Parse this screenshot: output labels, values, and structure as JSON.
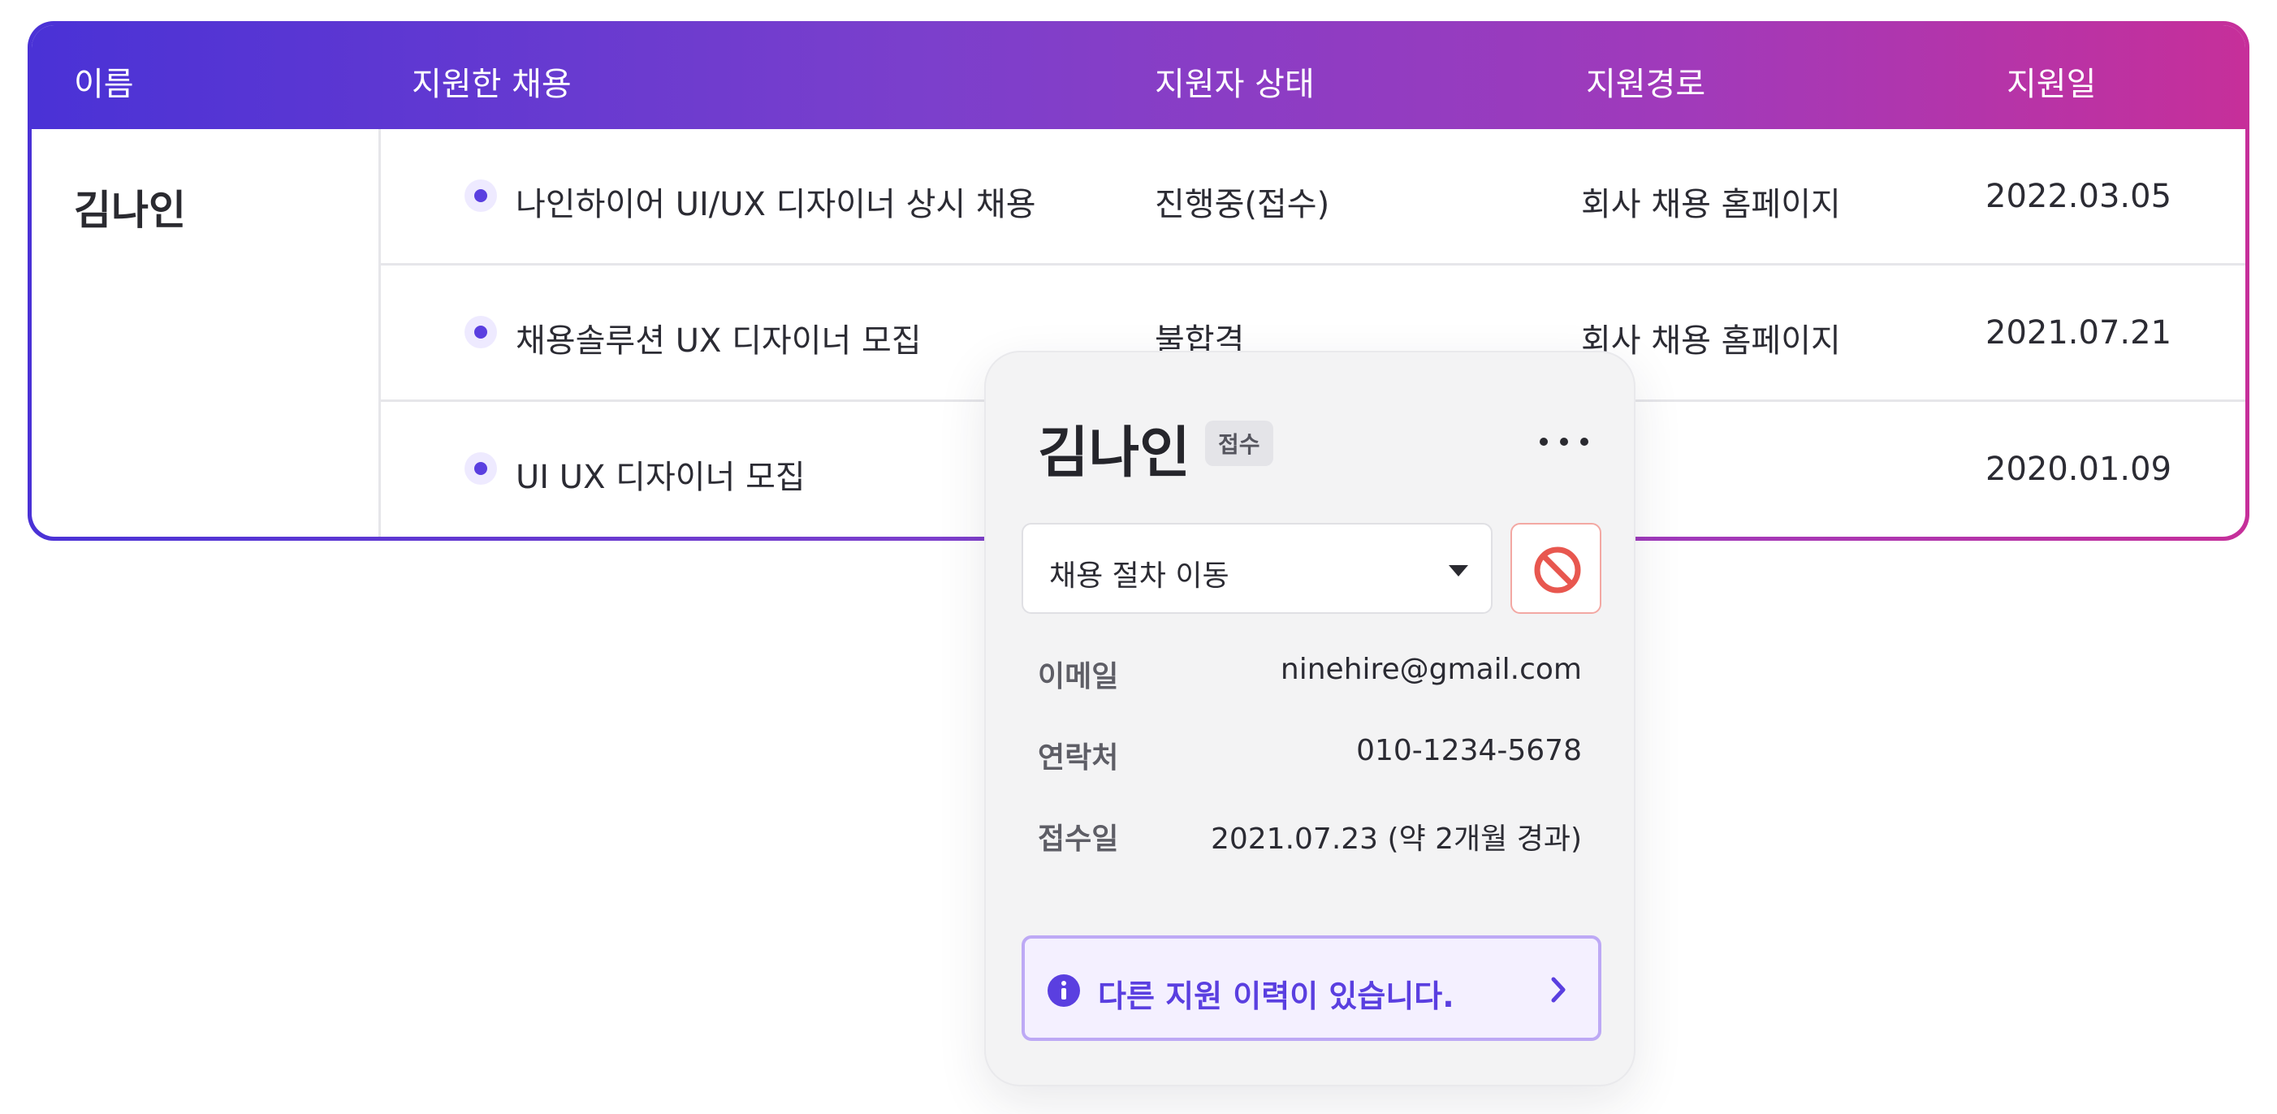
{
  "table": {
    "headers": {
      "name": "이름",
      "job": "지원한 채용",
      "status": "지원자 상태",
      "source": "지원경로",
      "date": "지원일"
    },
    "applicant_name": "김나인",
    "rows": [
      {
        "job": "나인하이어 UI/UX 디자이너 상시 채용",
        "status": "진행중(접수)",
        "source": "회사 채용 홈페이지",
        "date": "2022.03.05"
      },
      {
        "job": "채용솔루션 UX 디자이너 모집",
        "status": "불합격",
        "source": "회사 채용 홈페이지",
        "date": "2021.07.21"
      },
      {
        "job": "UI UX 디자이너 모집",
        "status": "",
        "source": "",
        "date": "2020.01.09"
      }
    ]
  },
  "card": {
    "name": "김나인",
    "badge": "접수",
    "select_label": "채용 절차 이동",
    "info": [
      {
        "label": "이메일",
        "value": "ninehire@gmail.com"
      },
      {
        "label": "연락처",
        "value": "010-1234-5678"
      },
      {
        "label": "접수일",
        "value": "2021.07.23 (약 2개월 경과)"
      }
    ],
    "notice": "다른 지원 이력이 있습니다."
  },
  "colors": {
    "gradient_start": "#4a32d6",
    "gradient_end": "#c62f9a",
    "accent": "#5a3fe0",
    "danger": "#e8574f"
  },
  "icons": [
    "bullet-dot-icon",
    "more-horizontal-icon",
    "caret-down-icon",
    "block-icon",
    "info-icon",
    "chevron-right-icon"
  ]
}
